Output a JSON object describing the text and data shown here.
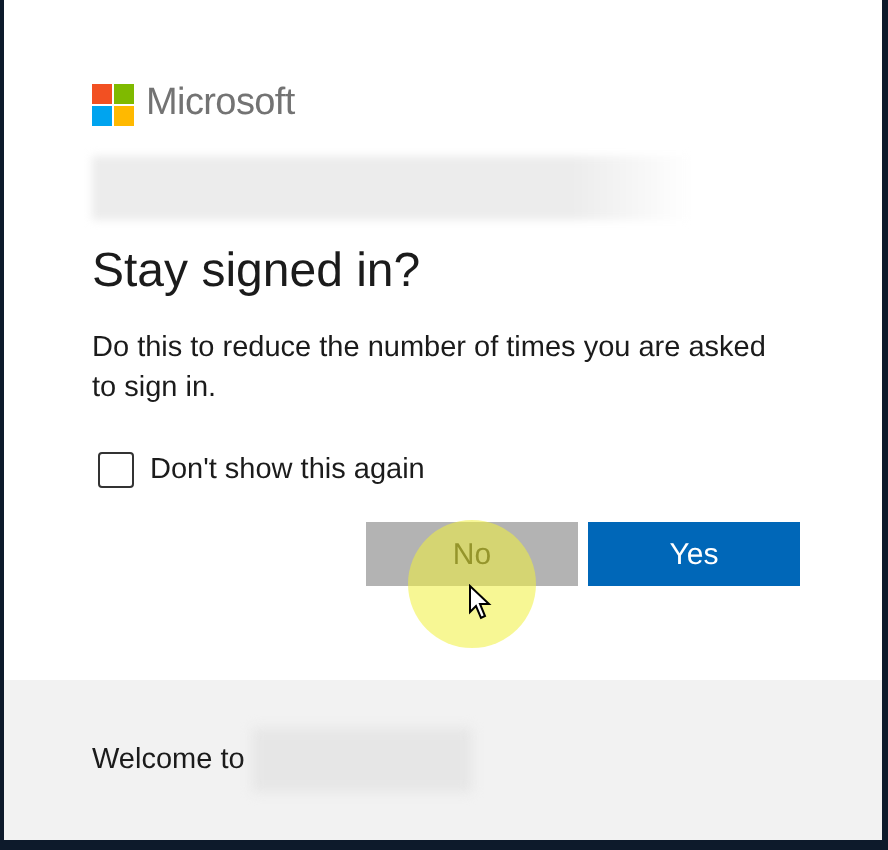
{
  "brand": {
    "name": "Microsoft"
  },
  "title": "Stay signed in?",
  "description": "Do this to reduce the number of times you are asked to sign in.",
  "checkbox": {
    "label": "Don't show this again",
    "checked": false
  },
  "buttons": [
    {
      "label": "No",
      "kind": "secondary"
    },
    {
      "label": "Yes",
      "kind": "primary"
    }
  ],
  "footer": {
    "text": "Welcome to"
  }
}
